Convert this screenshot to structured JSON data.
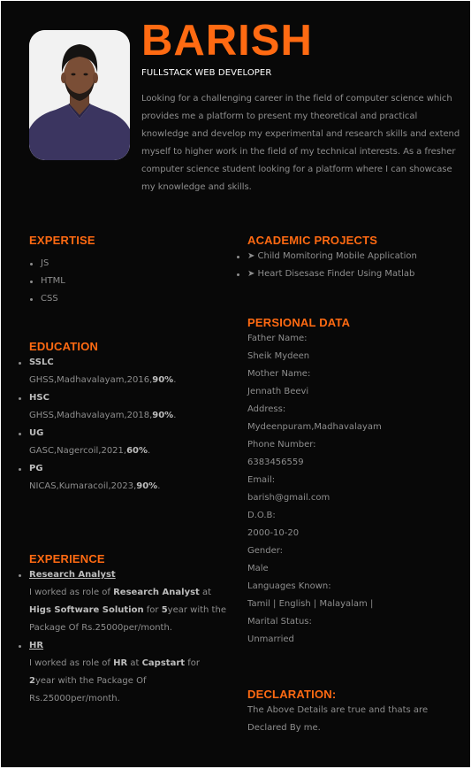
{
  "header": {
    "name": "BARISH",
    "title": "FULLSTACK WEB DEVELOPER",
    "objective_lines": [
      "Looking for a challenging career in the field of computer science which",
      "provides me a platform to present my theoretical and practical",
      "knowledge and develop my experimental and research skills and extend",
      "myself to higher work in the field of my technical interests. As a fresher",
      "computer science student looking for a platform where I can showcase",
      "my knowledge and skills."
    ]
  },
  "expertise": {
    "heading": "EXPERTISE",
    "items": [
      "JS",
      "HTML",
      "CSS"
    ]
  },
  "education": {
    "heading": "EDUCATION",
    "items": [
      {
        "degree": "SSLC",
        "detail": "GHSS,Madhavalayam,2016,",
        "score": "90%",
        "end": "."
      },
      {
        "degree": "HSC",
        "detail": "GHSS,Madhavalayam,2018,",
        "score": "90%",
        "end": "."
      },
      {
        "degree": "UG",
        "detail": "GASC,Nagercoil,2021,",
        "score": "60%",
        "end": "."
      },
      {
        "degree": "PG",
        "detail": "NICAS,Kumaracoil,2023,",
        "score": "90%",
        "end": "."
      }
    ]
  },
  "experience": {
    "heading": "EXPERIENCE",
    "items": [
      {
        "role": "Research Analyst",
        "l1_a": "I worked as role of ",
        "l1_b": "Research Analyst",
        "l1_c": " at",
        "l2_a": "Higs Software Solution",
        "l2_b": " for ",
        "l2_c": "5",
        "l2_d": "year with the",
        "l3": "Package Of Rs.25000per/month."
      },
      {
        "role": "HR",
        "l1_a": "I worked as role of ",
        "l1_b": "HR",
        "l1_c": " at ",
        "l1_d": "Capstart",
        "l1_e": " for",
        "l2_a": "2",
        "l2_b": "year with the Package Of",
        "l3": "Rs.25000per/month."
      }
    ]
  },
  "projects": {
    "heading": "ACADEMIC PROJECTS",
    "items": [
      "➤ Child Momitoring Mobile Application",
      "➤ Heart Disesase Finder Using Matlab"
    ]
  },
  "personal": {
    "heading": "PERSIONAL DATA",
    "lines": [
      "Father Name:",
      "Sheik Mydeen",
      "Mother Name:",
      "Jennath Beevi",
      "Address:",
      "Mydeenpuram,Madhavalayam",
      "Phone Number:",
      "6383456559",
      "Email:",
      "barish@gmail.com",
      "D.O.B:",
      "2000-10-20",
      "Gender:",
      "Male",
      "Languages Known:",
      "Tamil | English | Malayalam |",
      "Marital Status:",
      "Unmarried"
    ]
  },
  "declaration": {
    "heading": "DECLARATION:",
    "lines": [
      "The Above Details are true and thats are",
      "Declared By me."
    ]
  },
  "colors": {
    "accent": "#ff6a12",
    "background": "#080808",
    "body_text": "#8e8e8e"
  }
}
